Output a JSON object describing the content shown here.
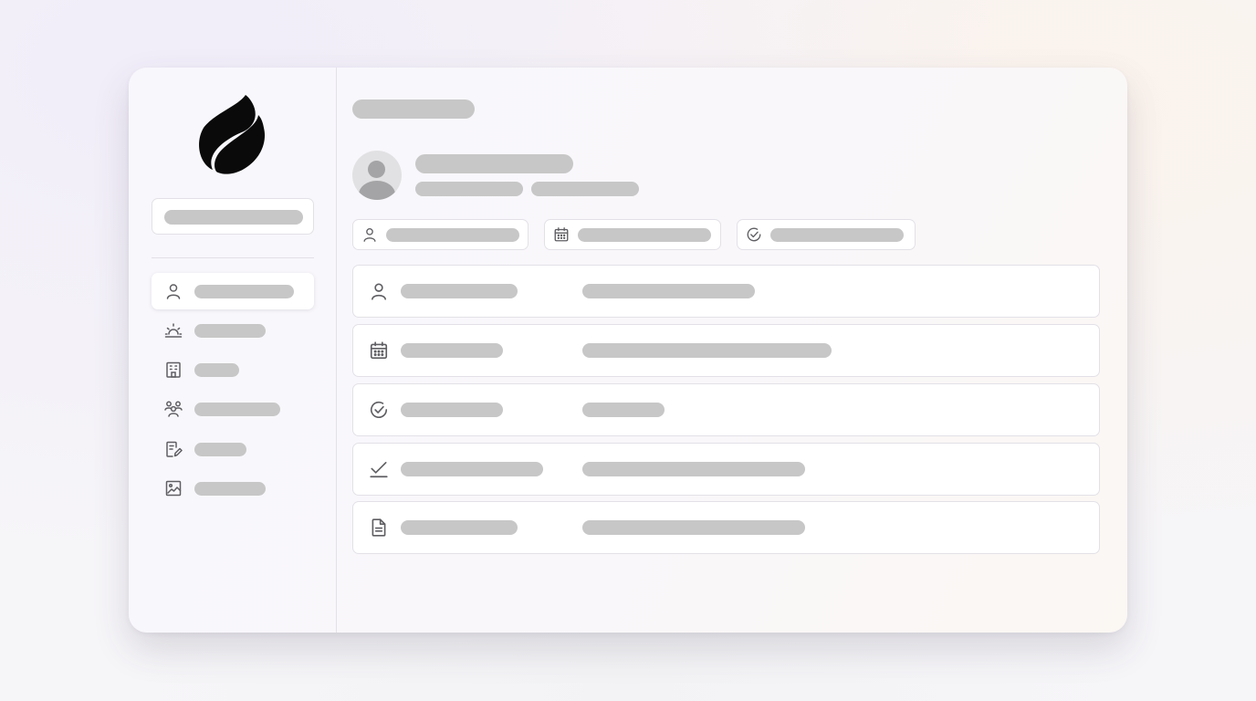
{
  "colors": {
    "placeholder_bar": "#c7c7c7",
    "icon_stroke": "#5f5f63",
    "logo": "#0a0a0a",
    "card_bg": "#ffffff",
    "border": "#e3e1e7"
  },
  "sidebar": {
    "logo_icon": "flame-logo-icon",
    "search": {
      "value": ""
    },
    "items": [
      {
        "icon": "user-icon",
        "label": "",
        "active": true
      },
      {
        "icon": "sunrise-icon",
        "label": ""
      },
      {
        "icon": "building-icon",
        "label": ""
      },
      {
        "icon": "users-icon",
        "label": ""
      },
      {
        "icon": "edit-note-icon",
        "label": ""
      },
      {
        "icon": "image-icon",
        "label": ""
      }
    ]
  },
  "main": {
    "page_title": "",
    "profile": {
      "avatar_icon": "avatar-placeholder-icon",
      "name": "",
      "meta": [
        "",
        ""
      ]
    },
    "chips": [
      {
        "icon": "user-icon",
        "label": ""
      },
      {
        "icon": "calendar-icon",
        "label": ""
      },
      {
        "icon": "check-circle-icon",
        "label": ""
      }
    ],
    "rows": [
      {
        "icon": "user-icon",
        "label": "",
        "value": ""
      },
      {
        "icon": "calendar-icon",
        "label": "",
        "value": ""
      },
      {
        "icon": "check-circle-icon",
        "label": "",
        "value": ""
      },
      {
        "icon": "checkmark-icon",
        "label": "",
        "value": ""
      },
      {
        "icon": "document-icon",
        "label": "",
        "value": ""
      }
    ]
  }
}
